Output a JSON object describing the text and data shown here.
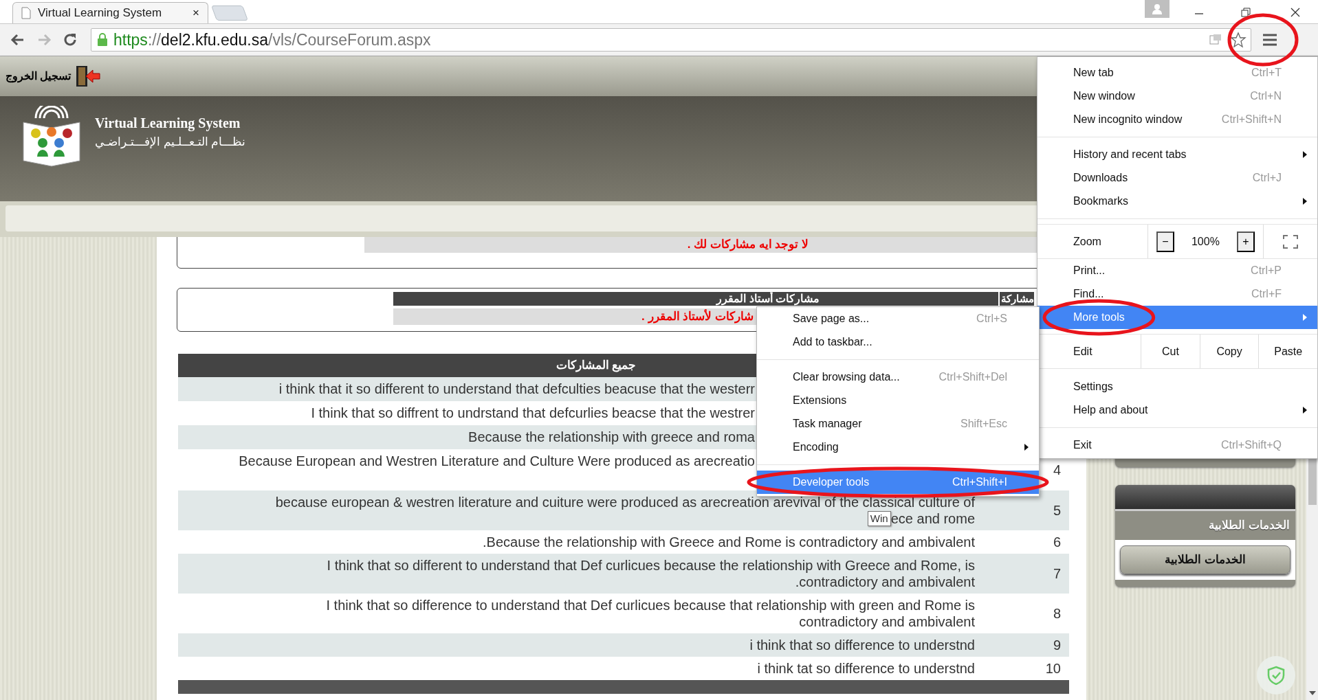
{
  "browser": {
    "tab_title": "Virtual Learning System",
    "tab_close": "×",
    "url": {
      "scheme": "https",
      "separator": "://",
      "host": "del2.kfu.edu.sa",
      "path": "/vls/CourseForum.aspx"
    },
    "menu_button_circled": true
  },
  "page": {
    "logout": "تسجيل الخروج",
    "site_title": "Virtual Learning System",
    "site_subtitle": "نظـــام التـعــلـيم الإفـــتـراضـي",
    "my_posts": {
      "message": "لا توجد ايه مشاركات لك ."
    },
    "instructor_posts": {
      "title": "مشاركات أستاذ المقرر",
      "column_2": "مشاركة",
      "message": "شاركات لأستاذ المقرر ."
    },
    "all_posts": {
      "title": "جميع المشاركات",
      "rows": [
        {
          "kind": "clipped",
          "lines": [
            "i think that it so different to understand that defculties beacuse that the westerr"
          ]
        },
        {
          "kind": "clipped",
          "lines": [
            "I think that so diffrent to undrstand that defcurlies beacse that the westrer"
          ]
        },
        {
          "kind": "clipped",
          "lines": [
            "Because the relationship with greece and roma"
          ]
        },
        {
          "kind": "clipped_wrapped",
          "lines": [
            "Because European and Westren Literature and Culture Were produced as arecreatio"
          ],
          "number": "4"
        },
        {
          "kind": "full",
          "lines": [
            "because european & westren literature and cuiture were produced as arecreation arevival of the classical culture of",
            "ece and rome"
          ],
          "tooltip": "Win",
          "number": "5"
        },
        {
          "kind": "full",
          "lines": [
            ".Because the relationship with Greece and Rome is contradictory and ambivalent"
          ],
          "number": "6"
        },
        {
          "kind": "full",
          "lines": [
            "I think that so different to understand that Def curlicues because the relationship with Greece and Rome, is",
            ".contradictory and ambivalent"
          ],
          "number": "7"
        },
        {
          "kind": "full",
          "lines": [
            "I think that so difference to understand that Def curlicues because that relationship with green and Rome is",
            "contradictory and ambivalent"
          ],
          "number": "8"
        },
        {
          "kind": "full",
          "lines": [
            "i think that so difference to understnd"
          ],
          "number": "9"
        },
        {
          "kind": "full",
          "lines": [
            "i think tat so difference to understnd"
          ],
          "number": "10"
        }
      ]
    },
    "sidebar": {
      "card_title": "الخدمات الطلابية",
      "button": "الخدمات الطلابية"
    }
  },
  "main_menu": {
    "items": [
      {
        "kind": "item",
        "label": "New tab",
        "shortcut": "Ctrl+T",
        "selected": false
      },
      {
        "kind": "item",
        "label": "New window",
        "shortcut": "Ctrl+N",
        "selected": false
      },
      {
        "kind": "item",
        "label": "New incognito window",
        "shortcut": "Ctrl+Shift+N",
        "selected": false
      },
      {
        "kind": "separator"
      },
      {
        "kind": "item",
        "label": "History and recent tabs",
        "has_submenu": true,
        "selected": false
      },
      {
        "kind": "item",
        "label": "Downloads",
        "shortcut": "Ctrl+J",
        "selected": false
      },
      {
        "kind": "item",
        "label": "Bookmarks",
        "has_submenu": true,
        "selected": false
      },
      {
        "kind": "separator"
      },
      {
        "kind": "zoom",
        "label": "Zoom",
        "minus": "−",
        "value": "100%",
        "plus": "+"
      },
      {
        "kind": "item",
        "label": "Print...",
        "shortcut": "Ctrl+P",
        "selected": false
      },
      {
        "kind": "item",
        "label": "Find...",
        "shortcut": "Ctrl+F",
        "selected": false
      },
      {
        "kind": "item",
        "label": "More tools",
        "has_submenu": true,
        "selected": true,
        "circled": true
      },
      {
        "kind": "edit",
        "label": "Edit",
        "actions": [
          "Cut",
          "Copy",
          "Paste"
        ]
      },
      {
        "kind": "item",
        "label": "Settings",
        "selected": false
      },
      {
        "kind": "item",
        "label": "Help and about",
        "has_submenu": true,
        "selected": false
      },
      {
        "kind": "separator"
      },
      {
        "kind": "item",
        "label": "Exit",
        "shortcut": "Ctrl+Shift+Q",
        "selected": false
      }
    ]
  },
  "more_tools_menu": {
    "items": [
      {
        "kind": "item",
        "label": "Save page as...",
        "shortcut": "Ctrl+S",
        "selected": false
      },
      {
        "kind": "item",
        "label": "Add to taskbar...",
        "selected": false
      },
      {
        "kind": "separator"
      },
      {
        "kind": "item",
        "label": "Clear browsing data...",
        "shortcut": "Ctrl+Shift+Del",
        "selected": false
      },
      {
        "kind": "item",
        "label": "Extensions",
        "selected": false
      },
      {
        "kind": "item",
        "label": "Task manager",
        "shortcut": "Shift+Esc",
        "selected": false
      },
      {
        "kind": "item",
        "label": "Encoding",
        "has_submenu": true,
        "selected": false
      },
      {
        "kind": "separator"
      },
      {
        "kind": "item",
        "label": "Developer tools",
        "shortcut": "Ctrl+Shift+I",
        "selected": true,
        "circled": true
      }
    ]
  }
}
